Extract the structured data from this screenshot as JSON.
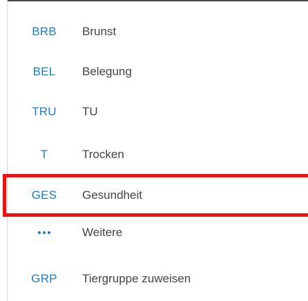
{
  "menu": {
    "items": [
      {
        "code": "BRB",
        "label": "Brunst"
      },
      {
        "code": "BEL",
        "label": "Belegung"
      },
      {
        "code": "TRU",
        "label": "TU"
      },
      {
        "code": "T",
        "label": "Trocken"
      },
      {
        "code": "GES",
        "label": "Gesundheit"
      },
      {
        "code": "...",
        "label": "Weitere",
        "icon": "more-dots-icon"
      },
      {
        "code": "GRP",
        "label": "Tiergruppe zuweisen"
      }
    ],
    "highlighted_item": "Gesundheit"
  },
  "colors": {
    "code": "#1a7fc1",
    "label": "#444444",
    "highlight": "#f01010"
  }
}
